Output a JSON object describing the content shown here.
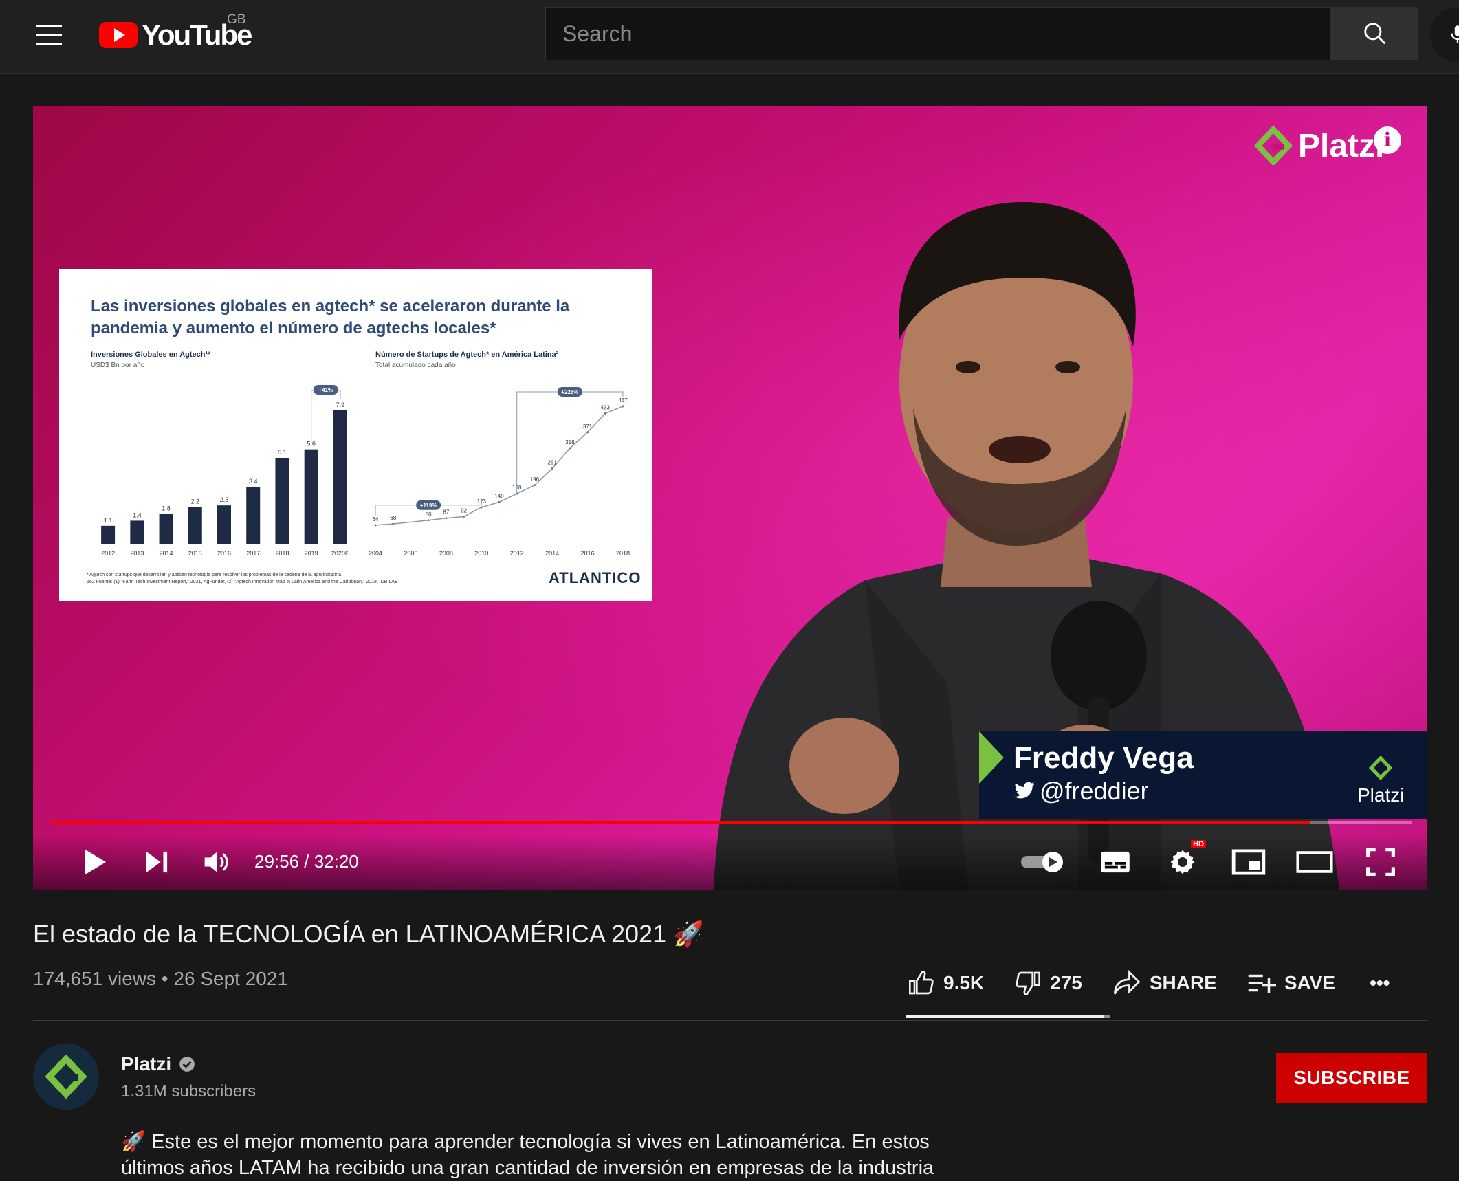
{
  "masthead": {
    "logo_text": "YouTube",
    "country_code": "GB",
    "search_placeholder": "Search"
  },
  "player": {
    "progress_fraction": 0.925,
    "buffer_fraction": 0.99,
    "time_display": "29:56 / 32:20",
    "hd_badge": "HD",
    "watermark_text": "Platzi",
    "info_icon_text": "i",
    "lower_third": {
      "name": "Freddy Vega",
      "handle": "@freddier",
      "logo_text": "Platzi"
    },
    "slide": {
      "title": "Las inversiones globales en agtech* se aceleraron durante la pandemia y aumento el número de agtechs locales*",
      "left_chart_title": "Inversiones Globales en Agtech¹*",
      "left_chart_subtitle": "USD$ Bn por año",
      "right_chart_title": "Número de Startups de Agtech* en América Latina²",
      "right_chart_subtitle": "Total acumulado cada año",
      "footnote_1": "* Agtech son startups que desarrollan y aplican tecnología para resolver los problemas de la cadena de la agroindustria",
      "footnote_2": "Fuente: (1) \"Farm Tech Investment Report,\" 2021, AgFunder, (2) \"Agtech Innovation Map in Latin America and the Caribbean,\" 2018, IDB LAB",
      "page_number": "162",
      "brand": "ATLANTICO"
    }
  },
  "chart_data": [
    {
      "type": "bar",
      "title": "Inversiones Globales en Agtech¹*",
      "subtitle": "USD$ Bn por año",
      "categories": [
        "2012",
        "2013",
        "2014",
        "2015",
        "2016",
        "2017",
        "2018",
        "2019",
        "2020E"
      ],
      "values": [
        1.1,
        1.4,
        1.8,
        2.2,
        2.3,
        3.4,
        5.1,
        5.6,
        7.9
      ],
      "annotation": "+41%",
      "ylim": [
        0,
        8.5
      ]
    },
    {
      "type": "line",
      "title": "Número de Startups de Agtech* en América Latina²",
      "subtitle": "Total acumulado cada año",
      "x": [
        "2004",
        "2005",
        "2006",
        "2007",
        "2008",
        "2009",
        "2010",
        "2011",
        "2012",
        "2013",
        "2014",
        "2015",
        "2016",
        "2017",
        "2018"
      ],
      "x_tick_labels": [
        "2004",
        "2006",
        "2008",
        "2010",
        "2012",
        "2014",
        "2016",
        "2018"
      ],
      "values": [
        64,
        68,
        80,
        87,
        92,
        123,
        140,
        168,
        196,
        251,
        318,
        371,
        433,
        457
      ],
      "annotations": [
        "+119%",
        "+226%"
      ],
      "ylim": [
        0,
        500
      ]
    }
  ],
  "video": {
    "title": "El estado de la TECNOLOGÍA en LATINOAMÉRICA 2021 🚀",
    "views": "174,651 views",
    "date": "26 Sept 2021",
    "likes": "9.5K",
    "dislikes": "275",
    "share_label": "SHARE",
    "save_label": "SAVE",
    "more_label": "•••",
    "like_ratio": 0.972
  },
  "channel": {
    "name": "Platzi",
    "subscribers": "1.31M subscribers",
    "subscribe_label": "SUBSCRIBE"
  },
  "description": {
    "line1": "🚀 Este es el mejor momento para aprender tecnología si vives en Latinoamérica. En estos",
    "line2": "últimos años LATAM ha recibido una gran cantidad de inversión en empresas de la industria"
  },
  "colors": {
    "accent_red": "#ff0000",
    "subscribe_red": "#cc0000",
    "platzi_green": "#7ac141",
    "slide_navy": "#1f2f4a",
    "background_magenta": "#c8107a"
  }
}
